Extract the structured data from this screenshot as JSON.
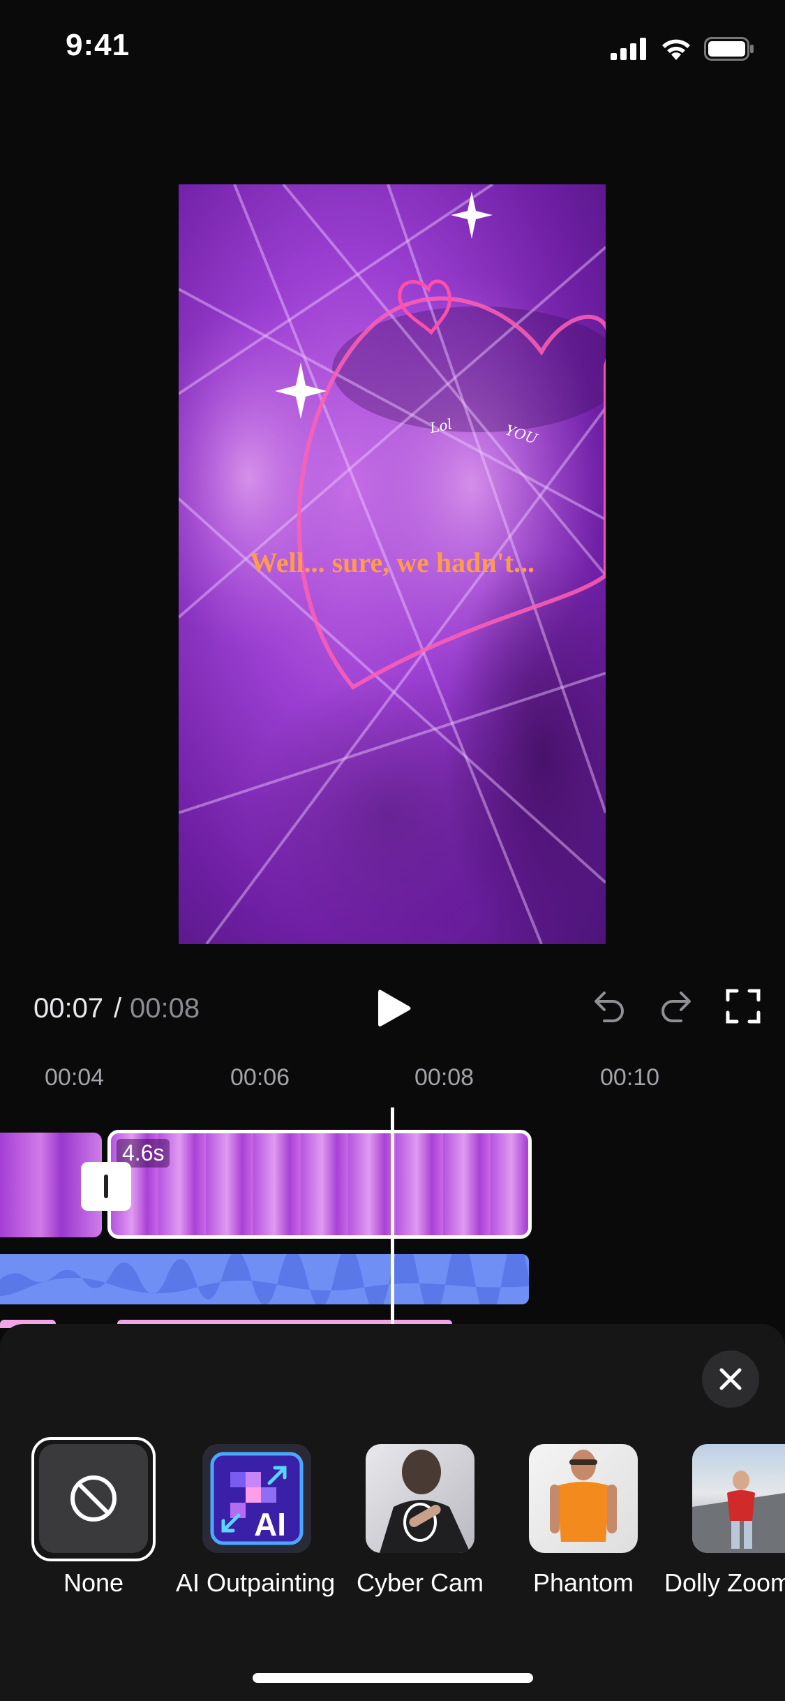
{
  "status_bar": {
    "time": "9:41",
    "icons": [
      "signal-icon",
      "wifi-icon",
      "battery-icon"
    ]
  },
  "preview": {
    "caption": "Well... sure, we hadn't...",
    "sticker_words": [
      "Lol",
      "YOU"
    ]
  },
  "playback": {
    "current_time": "00:07",
    "separator": "/",
    "total_time": "00:08",
    "controls": [
      "play-icon",
      "undo-icon",
      "redo-icon",
      "fullscreen-icon"
    ]
  },
  "ruler": {
    "labels": [
      "00:04",
      "00:06",
      "00:08",
      "00:10"
    ]
  },
  "timeline": {
    "selected_clip_duration": "4.6s"
  },
  "effects": {
    "items": [
      {
        "label": "None",
        "selected": true,
        "icon": "prohibited-icon"
      },
      {
        "label": "AI Outpainting",
        "badge": "AI"
      },
      {
        "label": "Cyber Cam"
      },
      {
        "label": "Phantom"
      },
      {
        "label": "Dolly Zoom"
      }
    ]
  },
  "colors": {
    "accent_audio": "#6f8ff5",
    "sheet_bg": "#161617",
    "caption": "#ff9b4d"
  }
}
